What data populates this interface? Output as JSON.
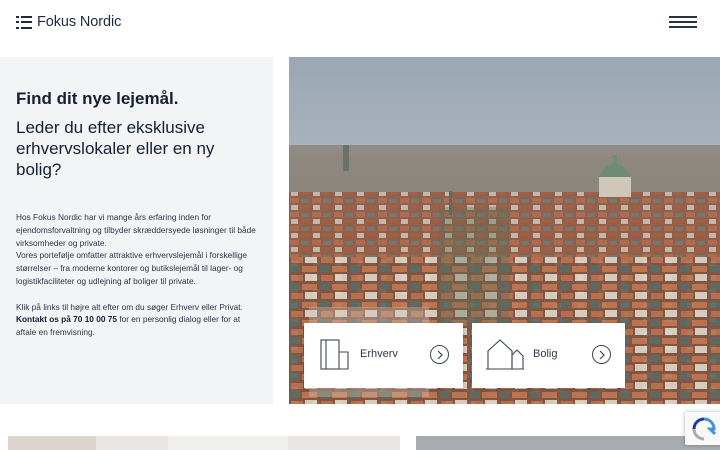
{
  "header": {
    "logo_text": "Fokus Nordic",
    "menu_icon": "hamburger-menu-icon"
  },
  "hero": {
    "title": "Find dit nye lejemål.",
    "subtitle": "Leder du efter eksklusive erhvervslokaler eller en ny bolig?",
    "body_p1": "Hos Fokus Nordic har vi mange års erfaring inden for ejendomsforvaltning og tilbyder skræddersyede løsninger til både virksomheder og private.",
    "body_p2": "Vores portefølje omfatter attraktive erhvervslejemål i forskellige størrelser – fra moderne kontorer og butikslejemål til lager- og logistikfaciliteter og udlejning af boliger til private.",
    "body_p3": "Klik på links til højre alt efter om du søger Erhverv eller Privat.",
    "contact_bold": "Kontakt os på 70 10 00 75",
    "contact_rest": " for en personlig dialog eller for at aftale en fremvisning."
  },
  "cards": {
    "erhverv_label": "Erhverv",
    "erhverv_icon": "office-building-icon",
    "bolig_label": "Bolig",
    "bolig_icon": "house-icon",
    "arrow_icon": "chevron-right-circle-icon"
  },
  "colors": {
    "brand_navy": "#1c2a44",
    "panel_bg": "#f3f4f6"
  }
}
